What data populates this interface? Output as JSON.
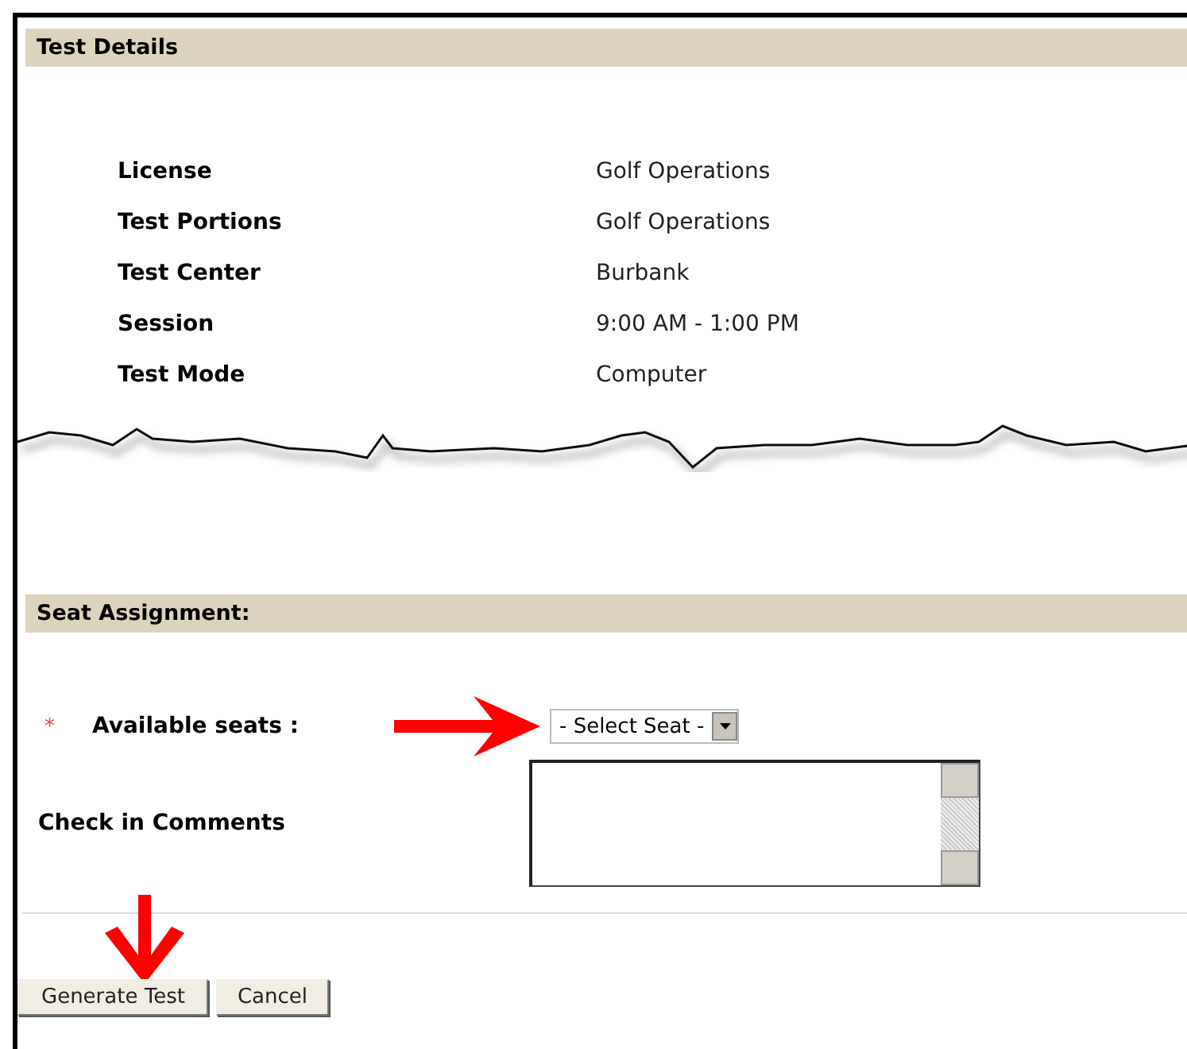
{
  "test_details": {
    "title": "Test Details",
    "rows": [
      {
        "label": "License",
        "value": "Golf Operations"
      },
      {
        "label": "Test Portions",
        "value": "Golf Operations"
      },
      {
        "label": "Test Center",
        "value": "Burbank"
      },
      {
        "label": "Session",
        "value": "9:00 AM - 1:00 PM"
      },
      {
        "label": "Test Mode",
        "value": "Computer"
      }
    ]
  },
  "seat_assignment": {
    "title": "Seat Assignment:",
    "required_mark": "*",
    "seats_label": "Available seats :",
    "seat_select": {
      "value": "- Select Seat -"
    },
    "comments_label": "Check in Comments"
  },
  "buttons": [
    "Generate Test",
    "Cancel"
  ]
}
